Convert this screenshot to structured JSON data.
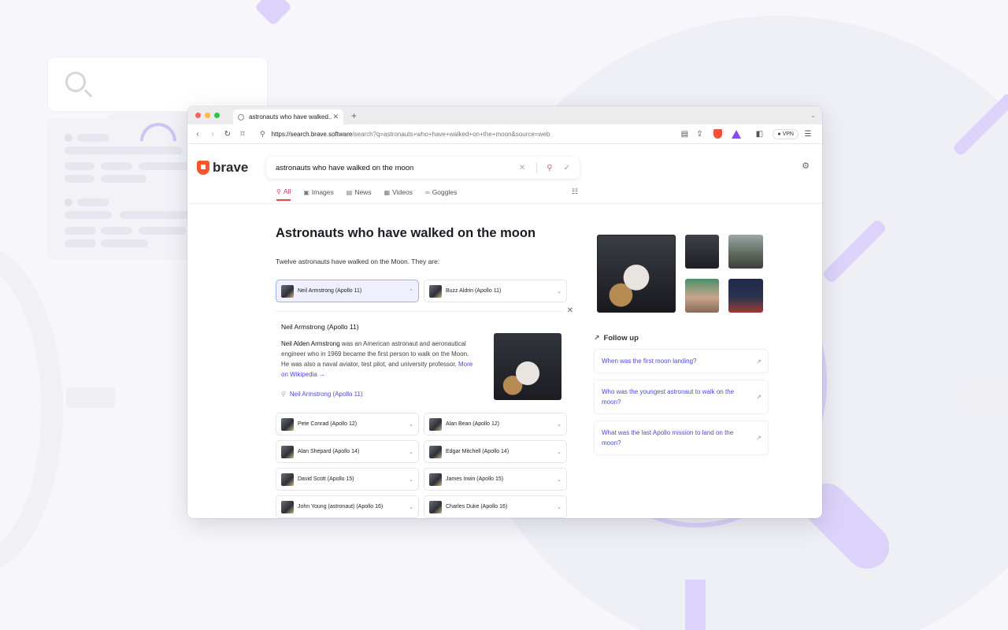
{
  "browser": {
    "tab_title": "astronauts who have walked...",
    "new_tab_icon": "+",
    "url_host": "https://search.brave.software",
    "url_path": "/search?q=astronauts+who+have+walked+on+the+moon&source=web",
    "vpn_label": "VPN"
  },
  "brand": {
    "name": "brave",
    "accent": "#fb542b"
  },
  "search": {
    "query": "astronauts who have walked on the moon"
  },
  "nav": {
    "tabs": [
      {
        "label": "All",
        "icon": "search-icon",
        "active": true
      },
      {
        "label": "Images",
        "icon": "image-icon"
      },
      {
        "label": "News",
        "icon": "news-icon"
      },
      {
        "label": "Videos",
        "icon": "video-icon"
      },
      {
        "label": "Goggles",
        "icon": "goggles-icon"
      }
    ]
  },
  "answer": {
    "title": "Astronauts who have walked on the moon",
    "lead": "Twelve astronauts have walked on the Moon. They are:",
    "top_chips": [
      "Neil Armstrong (Apollo 11)",
      "Buzz Aldrin (Apollo 11)"
    ],
    "detail": {
      "title": "Neil Armstrong (Apollo 11)",
      "bold_name": "Neil Alden Armstrong",
      "text": " was an American astronaut and aeronautical engineer who in 1969 became the first person to walk on the Moon. He was also a naval aviator, test pilot, and university professor. ",
      "more_link": "More on Wikipedia →",
      "search_link": "Neil Armstrong (Apollo 11)"
    },
    "chips": [
      "Pete Conrad (Apollo 12)",
      "Alan Bean (Apollo 12)",
      "Alan Shepard (Apollo 14)",
      "Edgar Mitchell (Apollo 14)",
      "David Scott (Apollo 15)",
      "James Irwin (Apollo 15)",
      "John Young (astronaut) (Apollo 16)",
      "Charles Duke (Apollo 16)"
    ]
  },
  "follow_up": {
    "heading": "Follow up",
    "questions": [
      "When was the first moon landing?",
      "Who was the youngest astronaut to walk on the moon?",
      "What was the last Apollo mission to land on the moon?"
    ]
  }
}
